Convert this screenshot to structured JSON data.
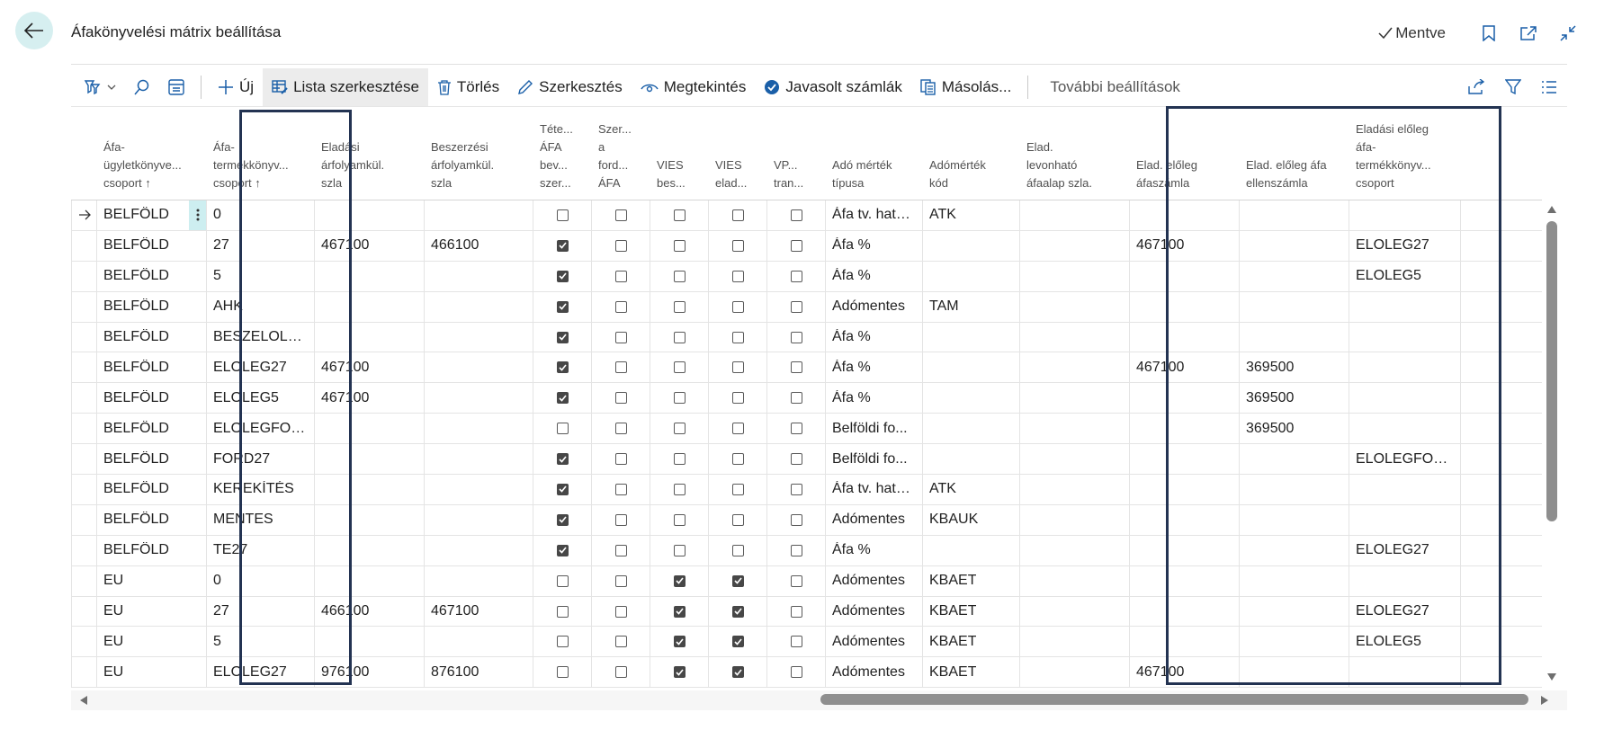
{
  "page": {
    "title": "Áfakönyvelési mátrix beállítása",
    "saved_label": "Mentve"
  },
  "toolbar": {
    "new_label": "Új",
    "edit_list_label": "Lista szerkesztése",
    "delete_label": "Törlés",
    "edit_label": "Szerkesztés",
    "view_label": "Megtekintés",
    "suggest_label": "Javasolt számlák",
    "copy_label": "Másolás...",
    "more_label": "További beállítások"
  },
  "table": {
    "headers": {
      "bus_group": [
        "Áfa-",
        "ügyletkönyve...",
        "csoport ↑"
      ],
      "prod_group": [
        "Áfa-",
        "termékkönyv...",
        "csoport ↑"
      ],
      "sales_acc": [
        "Eladási",
        "árfolyamkül.",
        "szla"
      ],
      "purch_acc": [
        "Beszerzési",
        "árfolyamkül.",
        "szla"
      ],
      "item_vat": [
        "Téte...",
        "ÁFA",
        "bev...",
        "szer..."
      ],
      "reverse": [
        "Szer...",
        "a",
        "ford...",
        "ÁFA"
      ],
      "vies_purch": [
        "VIES",
        "bes..."
      ],
      "vies_sales": [
        "VIES",
        "elad..."
      ],
      "vp_trans": [
        "VP...",
        "tran..."
      ],
      "tax_type": [
        "Adó mérték",
        "típusa"
      ],
      "tax_code": [
        "Adómérték",
        "kód"
      ],
      "deductible": [
        "Elad.",
        "levonható",
        "áfaalap szla."
      ],
      "prepay_acc": [
        "Elad. előleg",
        "áfaszámla"
      ],
      "prepay_contra": [
        "Elad. előleg áfa",
        "ellenszámla"
      ],
      "prepay_group": [
        "Eladási előleg",
        "áfa-",
        "termékkönyv...",
        "csoport"
      ]
    },
    "rows": [
      {
        "bus": "BELFÖLD",
        "prod": "0",
        "sales": "",
        "purch": "",
        "item": false,
        "rev": false,
        "vp": false,
        "vs": false,
        "tr": false,
        "type": "Áfa tv. hatá...",
        "code": "ATK",
        "ded": "",
        "pa": "",
        "pc": "",
        "pg": ""
      },
      {
        "bus": "BELFÖLD",
        "prod": "27",
        "sales": "467100",
        "purch": "466100",
        "item": true,
        "rev": false,
        "vp": false,
        "vs": false,
        "tr": false,
        "type": "Áfa %",
        "code": "",
        "ded": "",
        "pa": "467100",
        "pc": "",
        "pg": "ELOLEG27"
      },
      {
        "bus": "BELFÖLD",
        "prod": "5",
        "sales": "",
        "purch": "",
        "item": true,
        "rev": false,
        "vp": false,
        "vs": false,
        "tr": false,
        "type": "Áfa %",
        "code": "",
        "ded": "",
        "pa": "",
        "pc": "",
        "pg": "ELOLEG5"
      },
      {
        "bus": "BELFÖLD",
        "prod": "AHK",
        "sales": "",
        "purch": "",
        "item": true,
        "rev": false,
        "vp": false,
        "vs": false,
        "tr": false,
        "type": "Adómentes",
        "code": "TAM",
        "ded": "",
        "pa": "",
        "pc": "",
        "pg": ""
      },
      {
        "bus": "BELFÖLD",
        "prod": "BESZELOLEG...",
        "sales": "",
        "purch": "",
        "item": true,
        "rev": false,
        "vp": false,
        "vs": false,
        "tr": false,
        "type": "Áfa %",
        "code": "",
        "ded": "",
        "pa": "",
        "pc": "",
        "pg": ""
      },
      {
        "bus": "BELFÖLD",
        "prod": "ELOLEG27",
        "sales": "467100",
        "purch": "",
        "item": true,
        "rev": false,
        "vp": false,
        "vs": false,
        "tr": false,
        "type": "Áfa %",
        "code": "",
        "ded": "",
        "pa": "467100",
        "pc": "369500",
        "pg": ""
      },
      {
        "bus": "BELFÖLD",
        "prod": "ELOLEG5",
        "sales": "467100",
        "purch": "",
        "item": true,
        "rev": false,
        "vp": false,
        "vs": false,
        "tr": false,
        "type": "Áfa %",
        "code": "",
        "ded": "",
        "pa": "",
        "pc": "369500",
        "pg": ""
      },
      {
        "bus": "BELFÖLD",
        "prod": "ELOLEGFOR...",
        "sales": "",
        "purch": "",
        "item": false,
        "rev": false,
        "vp": false,
        "vs": false,
        "tr": false,
        "type": "Belföldi fo...",
        "code": "",
        "ded": "",
        "pa": "",
        "pc": "369500",
        "pg": ""
      },
      {
        "bus": "BELFÖLD",
        "prod": "FORD27",
        "sales": "",
        "purch": "",
        "item": true,
        "rev": false,
        "vp": false,
        "vs": false,
        "tr": false,
        "type": "Belföldi fo...",
        "code": "",
        "ded": "",
        "pa": "",
        "pc": "",
        "pg": "ELOLEGFORD..."
      },
      {
        "bus": "BELFÖLD",
        "prod": "KEREKÍTÉS",
        "sales": "",
        "purch": "",
        "item": true,
        "rev": false,
        "vp": false,
        "vs": false,
        "tr": false,
        "type": "Áfa tv. hatá...",
        "code": "ATK",
        "ded": "",
        "pa": "",
        "pc": "",
        "pg": ""
      },
      {
        "bus": "BELFÖLD",
        "prod": "MENTES",
        "sales": "",
        "purch": "",
        "item": true,
        "rev": false,
        "vp": false,
        "vs": false,
        "tr": false,
        "type": "Adómentes",
        "code": "KBAUK",
        "ded": "",
        "pa": "",
        "pc": "",
        "pg": ""
      },
      {
        "bus": "BELFÖLD",
        "prod": "TE27",
        "sales": "",
        "purch": "",
        "item": true,
        "rev": false,
        "vp": false,
        "vs": false,
        "tr": false,
        "type": "Áfa %",
        "code": "",
        "ded": "",
        "pa": "",
        "pc": "",
        "pg": "ELOLEG27"
      },
      {
        "bus": "EU",
        "prod": "0",
        "sales": "",
        "purch": "",
        "item": false,
        "rev": false,
        "vp": true,
        "vs": true,
        "tr": false,
        "type": "Adómentes",
        "code": "KBAET",
        "ded": "",
        "pa": "",
        "pc": "",
        "pg": ""
      },
      {
        "bus": "EU",
        "prod": "27",
        "sales": "466100",
        "purch": "467100",
        "item": false,
        "rev": false,
        "vp": true,
        "vs": true,
        "tr": false,
        "type": "Adómentes",
        "code": "KBAET",
        "ded": "",
        "pa": "",
        "pc": "",
        "pg": "ELOLEG27"
      },
      {
        "bus": "EU",
        "prod": "5",
        "sales": "",
        "purch": "",
        "item": false,
        "rev": false,
        "vp": true,
        "vs": true,
        "tr": false,
        "type": "Adómentes",
        "code": "KBAET",
        "ded": "",
        "pa": "",
        "pc": "",
        "pg": "ELOLEG5"
      },
      {
        "bus": "EU",
        "prod": "ELOLEG27",
        "sales": "976100",
        "purch": "876100",
        "item": false,
        "rev": false,
        "vp": true,
        "vs": true,
        "tr": false,
        "type": "Adómentes",
        "code": "KBAET",
        "ded": "",
        "pa": "467100",
        "pc": "",
        "pg": ""
      }
    ]
  },
  "colors": {
    "accent": "#d6eff0",
    "highlight_border": "#233352",
    "selected_cell": "#cdeef0"
  }
}
